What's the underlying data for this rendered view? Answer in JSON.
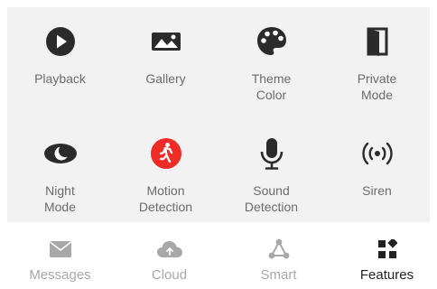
{
  "features": [
    {
      "label": "Playback",
      "icon": "play-circle-icon"
    },
    {
      "label": "Gallery",
      "icon": "gallery-icon"
    },
    {
      "label": "Theme\nColor",
      "icon": "palette-icon"
    },
    {
      "label": "Private\nMode",
      "icon": "private-mode-icon"
    },
    {
      "label": "Night\nMode",
      "icon": "night-mode-icon"
    },
    {
      "label": "Motion\nDetection",
      "icon": "motion-detection-icon",
      "color": "#ee2b24"
    },
    {
      "label": "Sound\nDetection",
      "icon": "microphone-icon"
    },
    {
      "label": "Siren",
      "icon": "siren-icon"
    }
  ],
  "tabs": [
    {
      "label": "Messages",
      "icon": "envelope-icon",
      "active": false
    },
    {
      "label": "Cloud",
      "icon": "cloud-icon",
      "active": false
    },
    {
      "label": "Smart",
      "icon": "smart-icon",
      "active": false
    },
    {
      "label": "Features",
      "icon": "grid-icon",
      "active": true
    }
  ],
  "colors": {
    "icon_dark": "#2b2b2b",
    "accent_red": "#ee2b24",
    "tab_inactive": "#a8a8a8",
    "tab_active": "#222222"
  }
}
